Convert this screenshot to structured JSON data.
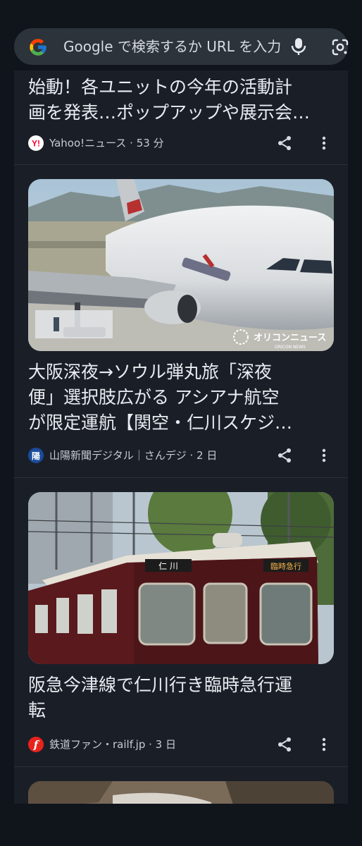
{
  "search": {
    "placeholder": "Google で検索するか URL を入力"
  },
  "colors": {
    "background": "#10151c",
    "card": "#1a1f27",
    "searchbar": "#2d333b",
    "yahoo_red": "#ff0033",
    "sanyo_blue": "#1b4b9b",
    "railf_red": "#e8231e"
  },
  "articles": [
    {
      "title": "始動！各ユニットの今年の活動計画を発表…ポップアップや展示会…",
      "title_line1": "始動！各ユニットの今年の活動計",
      "title_line2": "画を発表…ポップアップや展示会…",
      "source": "Yahoo!ニュース · 53 分",
      "source_icon": "yahoo-icon",
      "source_icon_letter": "Y!"
    },
    {
      "title": "大阪深夜→ソウル弾丸旅「深夜便」選択肢広がる アシアナ航空が限定運航【関空・仁川スケジ…",
      "title_line1": "大阪深夜→ソウル弾丸旅「深夜",
      "title_line2": "便」選択肢広がる アシアナ航空",
      "title_line3": "が限定運航【関空・仁川スケジ…",
      "source": "山陽新聞デジタル｜さんデジ · 2 日",
      "source_icon": "sanyo-news-icon",
      "source_icon_letter": "陽",
      "image": "airplane-photo",
      "image_caption": "オリコンニュース",
      "image_caption_sub": "ORICON NEWS"
    },
    {
      "title": "阪急今津線で仁川行き臨時急行運転",
      "title_line1": "阪急今津線で仁川行き臨時急行運",
      "title_line2": "転",
      "source": "鉄道ファン・railf.jp · 3 日",
      "source_icon": "railf-icon",
      "source_icon_letter": "f",
      "image": "train-photo",
      "train_sign_left": "仁 川",
      "train_sign_right": "臨時急行"
    }
  ]
}
